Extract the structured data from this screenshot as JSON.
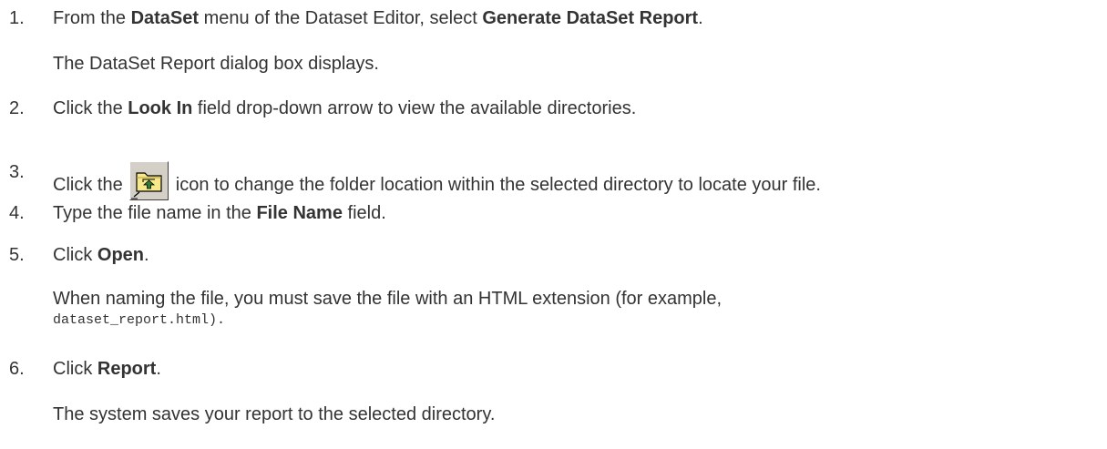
{
  "steps": [
    {
      "num": "1.",
      "pre": "From the ",
      "b1": "DataSet",
      "mid": " menu of the Dataset Editor, select ",
      "b2": "Generate DataSet Report",
      "post": ".",
      "note": "The DataSet Report dialog box displays."
    },
    {
      "num": "2.",
      "pre": "Click the ",
      "b1": "Look In",
      "post": " field drop-down arrow to view the available directories."
    },
    {
      "num": "3.",
      "pre": "Click the ",
      "icon": "folder-up-icon",
      "post": " icon to change the folder location within the selected directory to locate your file."
    },
    {
      "num": "4.",
      "pre": "Type the file name in the ",
      "b1": "File Name",
      "post": " field."
    },
    {
      "num": "5.",
      "pre": "Click ",
      "b1": "Open",
      "post": ".",
      "note": "When naming the file, you must save the file with an HTML extension (for example,",
      "code": "dataset_report.html)."
    },
    {
      "num": "6.",
      "pre": "Click ",
      "b1": "Report",
      "post": ".",
      "note": "The system saves your report to the selected directory."
    }
  ]
}
